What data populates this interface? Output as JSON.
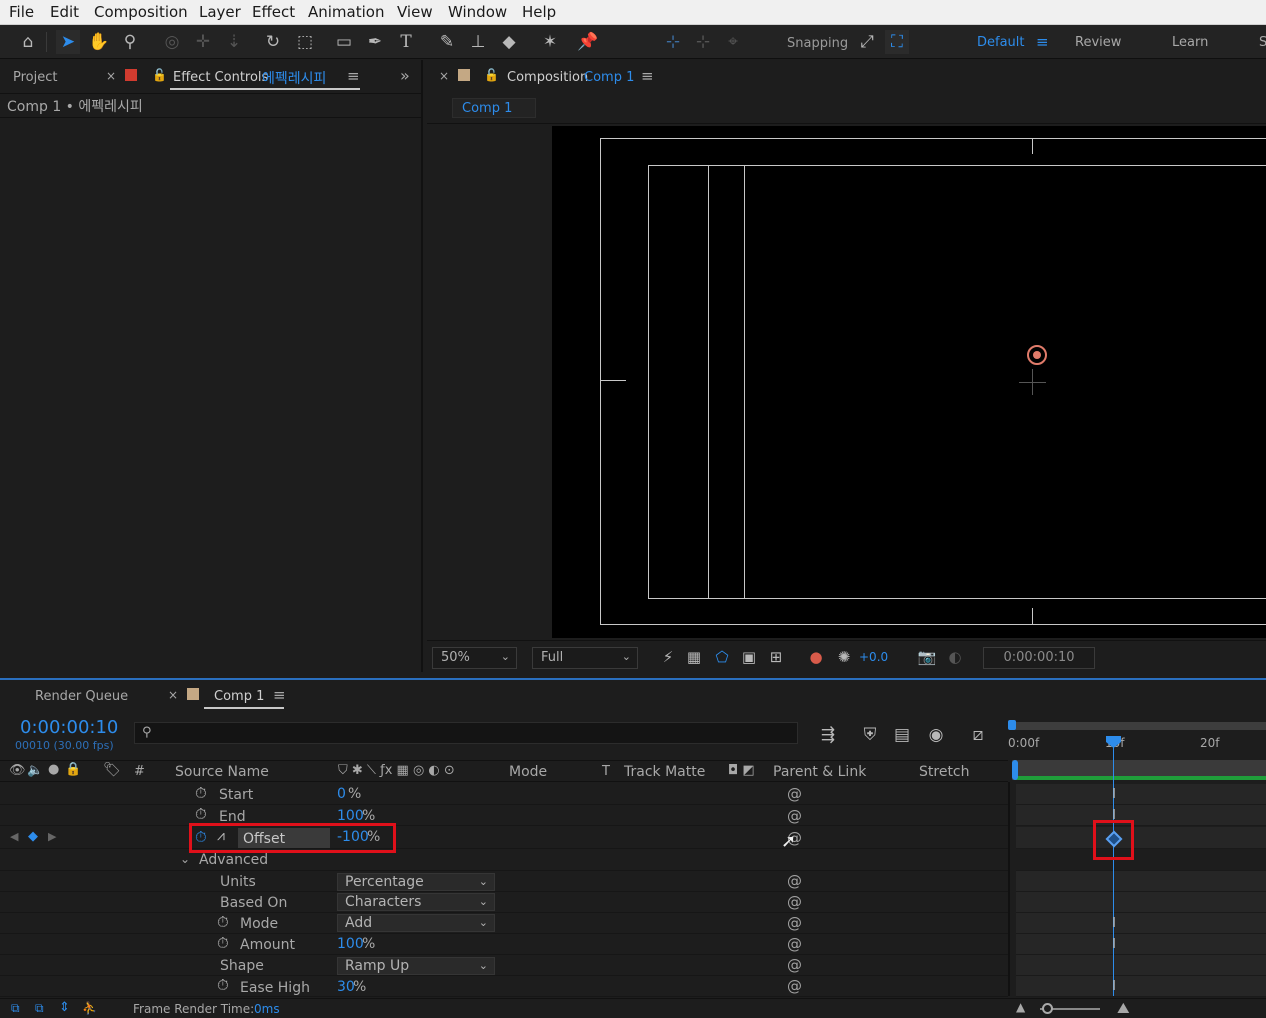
{
  "menu": [
    "File",
    "Edit",
    "Composition",
    "Layer",
    "Effect",
    "Animation",
    "View",
    "Window",
    "Help"
  ],
  "toolbar": {
    "snapping_label": "Snapping",
    "workspaces": [
      "Default",
      "Review",
      "Learn",
      "S"
    ]
  },
  "left_panel": {
    "project_tab": "Project",
    "effect_controls_tab": "Effect Controls",
    "effect_controls_layer": "에펙레시피",
    "breadcrumb": "Comp 1 • 에펙레시피"
  },
  "comp_panel": {
    "tab_label": "Composition",
    "tab_comp": "Comp 1",
    "comp_pill": "Comp 1"
  },
  "viewer_bar": {
    "zoom": "50%",
    "resolution": "Full",
    "exposure": "+0.0",
    "timecode": "0:00:00:10"
  },
  "timeline": {
    "render_queue_tab": "Render Queue",
    "comp_tab": "Comp 1",
    "current_time": "0:00:00:10",
    "frame_info": "00010 (30.00 fps)",
    "columns": {
      "source_name": "Source Name",
      "hash": "#",
      "mode": "Mode",
      "t": "T",
      "track_matte": "Track Matte",
      "parent_link": "Parent & Link",
      "stretch": "Stretch"
    },
    "ruler": [
      "0:00f",
      "10f",
      "20f"
    ],
    "properties": [
      {
        "name": "Start",
        "value": "0",
        "unit": "%"
      },
      {
        "name": "End",
        "value": "100",
        "unit": "%"
      },
      {
        "name": "Offset",
        "value": "-100",
        "unit": "%"
      }
    ],
    "advanced": {
      "label": "Advanced",
      "units": {
        "name": "Units",
        "value": "Percentage"
      },
      "based_on": {
        "name": "Based On",
        "value": "Characters"
      },
      "mode": {
        "name": "Mode",
        "value": "Add"
      },
      "amount": {
        "name": "Amount",
        "value": "100",
        "unit": "%"
      },
      "shape": {
        "name": "Shape",
        "value": "Ramp Up"
      },
      "ease_high": {
        "name": "Ease High",
        "value": "30",
        "unit": "%"
      }
    },
    "status_label": "Frame Render Time:",
    "status_value": "0ms"
  },
  "colors": {
    "accent_blue": "#2d8ceb",
    "highlight_red": "#e0101a",
    "layer_color_red": "#d13b2f",
    "comp_color_tan": "#c4a884",
    "timeline_green": "#1f9e3a"
  }
}
